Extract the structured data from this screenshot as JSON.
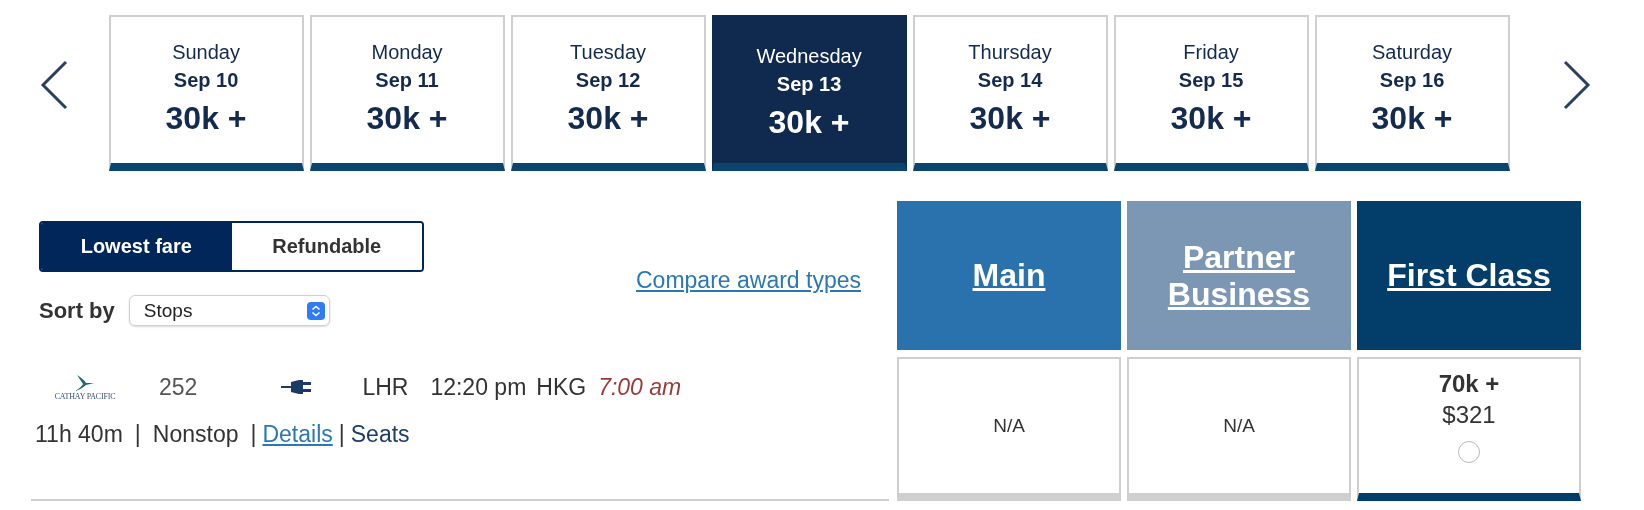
{
  "date_tabs": [
    {
      "day": "Sunday",
      "date": "Sep 10",
      "price": "30k +",
      "selected": false
    },
    {
      "day": "Monday",
      "date": "Sep 11",
      "price": "30k +",
      "selected": false
    },
    {
      "day": "Tuesday",
      "date": "Sep 12",
      "price": "30k +",
      "selected": false
    },
    {
      "day": "Wednesday",
      "date": "Sep 13",
      "price": "30k +",
      "selected": true
    },
    {
      "day": "Thursday",
      "date": "Sep 14",
      "price": "30k +",
      "selected": false
    },
    {
      "day": "Friday",
      "date": "Sep 15",
      "price": "30k +",
      "selected": false
    },
    {
      "day": "Saturday",
      "date": "Sep 16",
      "price": "30k +",
      "selected": false
    }
  ],
  "fare_toggle": [
    {
      "label": "Lowest fare",
      "selected": true
    },
    {
      "label": "Refundable",
      "selected": false
    }
  ],
  "sort": {
    "label": "Sort by",
    "value": "Stops"
  },
  "compare_link": "Compare award types",
  "fare_columns": [
    {
      "title": "Main",
      "color": "#2a72ad"
    },
    {
      "title": "Partner Business",
      "color": "#7b97b3"
    },
    {
      "title": "First Class",
      "color": "#033e6a"
    }
  ],
  "flight": {
    "airline_logo_text": "CATHAY PACIFIC",
    "flight_number": "252",
    "origin": "LHR",
    "depart_time": "12:20 pm",
    "destination": "HKG",
    "arrive_time": "7:00 am",
    "duration": "11h 40m",
    "stops": "Nonstop",
    "details_link": "Details",
    "seats_link": "Seats",
    "separators": [
      "|",
      "|",
      "|"
    ],
    "fares": [
      {
        "kind": "unavailable",
        "label": "N/A"
      },
      {
        "kind": "unavailable",
        "label": "N/A"
      },
      {
        "kind": "available",
        "miles": "70k +",
        "price": "$321",
        "selected": false
      }
    ]
  }
}
